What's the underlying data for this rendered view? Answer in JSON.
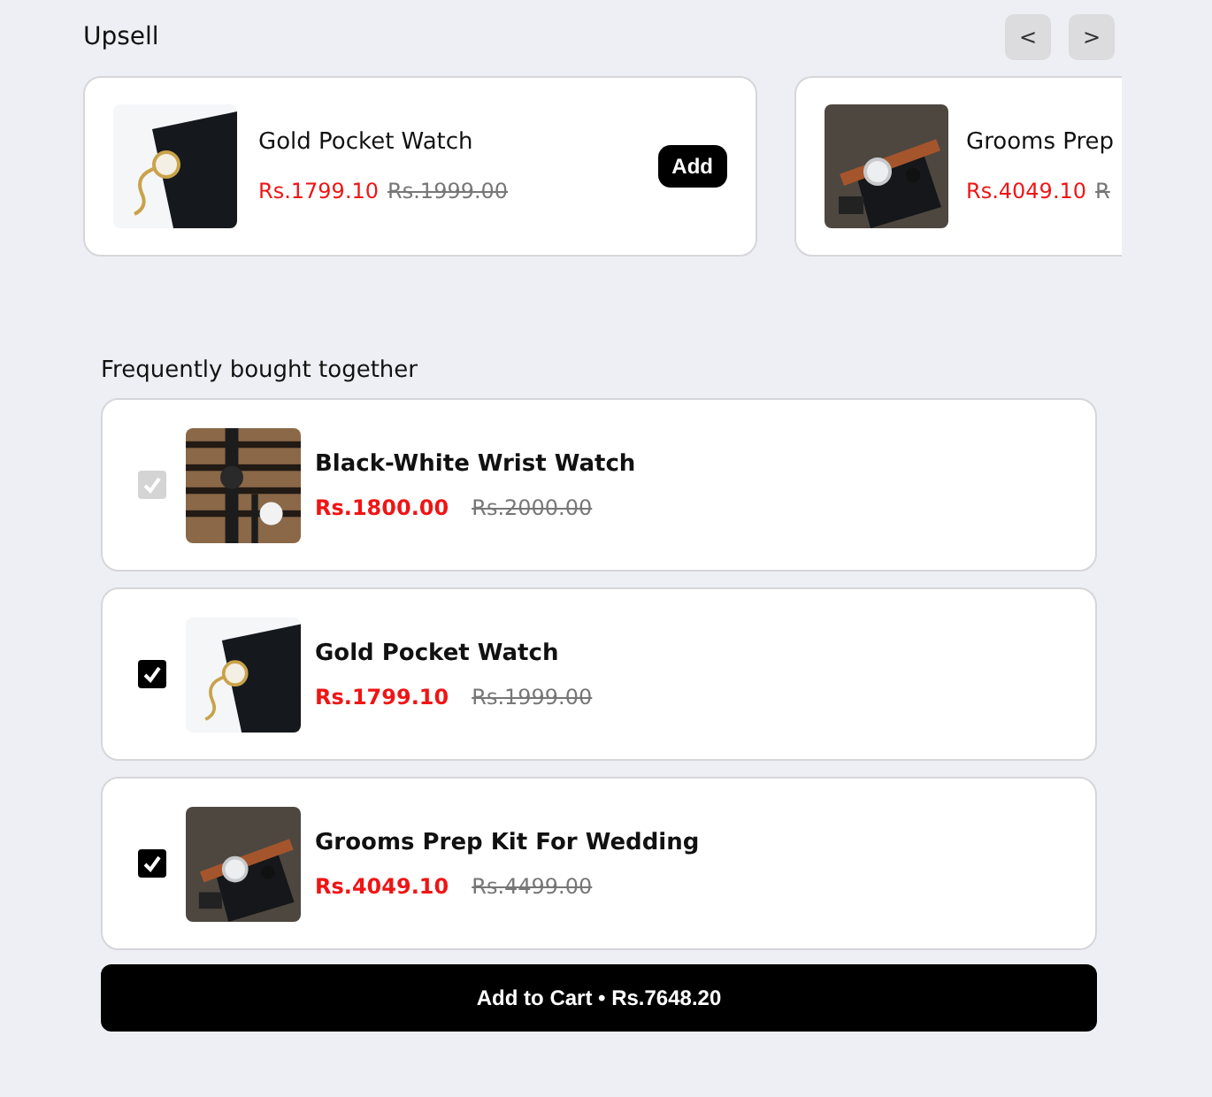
{
  "upsell": {
    "title": "Upsell",
    "nav": [
      "<",
      ">"
    ],
    "cards": [
      {
        "name": "Gold Pocket Watch",
        "price": "Rs.1799.10",
        "old_price": "Rs.1999.00",
        "button": "Add"
      },
      {
        "name": "Grooms Prep",
        "price": "Rs.4049.10",
        "old_price": "R"
      }
    ]
  },
  "bundle": {
    "title": "Frequently bought together",
    "items": [
      {
        "name": "Black-White Wrist Watch",
        "price": "Rs.1800.00",
        "old_price": "Rs.2000.00",
        "checked": true,
        "disabled": true
      },
      {
        "name": "Gold Pocket Watch",
        "price": "Rs.1799.10",
        "old_price": "Rs.1999.00",
        "checked": true,
        "disabled": false
      },
      {
        "name": "Grooms Prep Kit For Wedding",
        "price": "Rs.4049.10",
        "old_price": "Rs.4499.00",
        "checked": true,
        "disabled": false
      }
    ],
    "button": "Add to Cart • Rs.7648.20"
  }
}
